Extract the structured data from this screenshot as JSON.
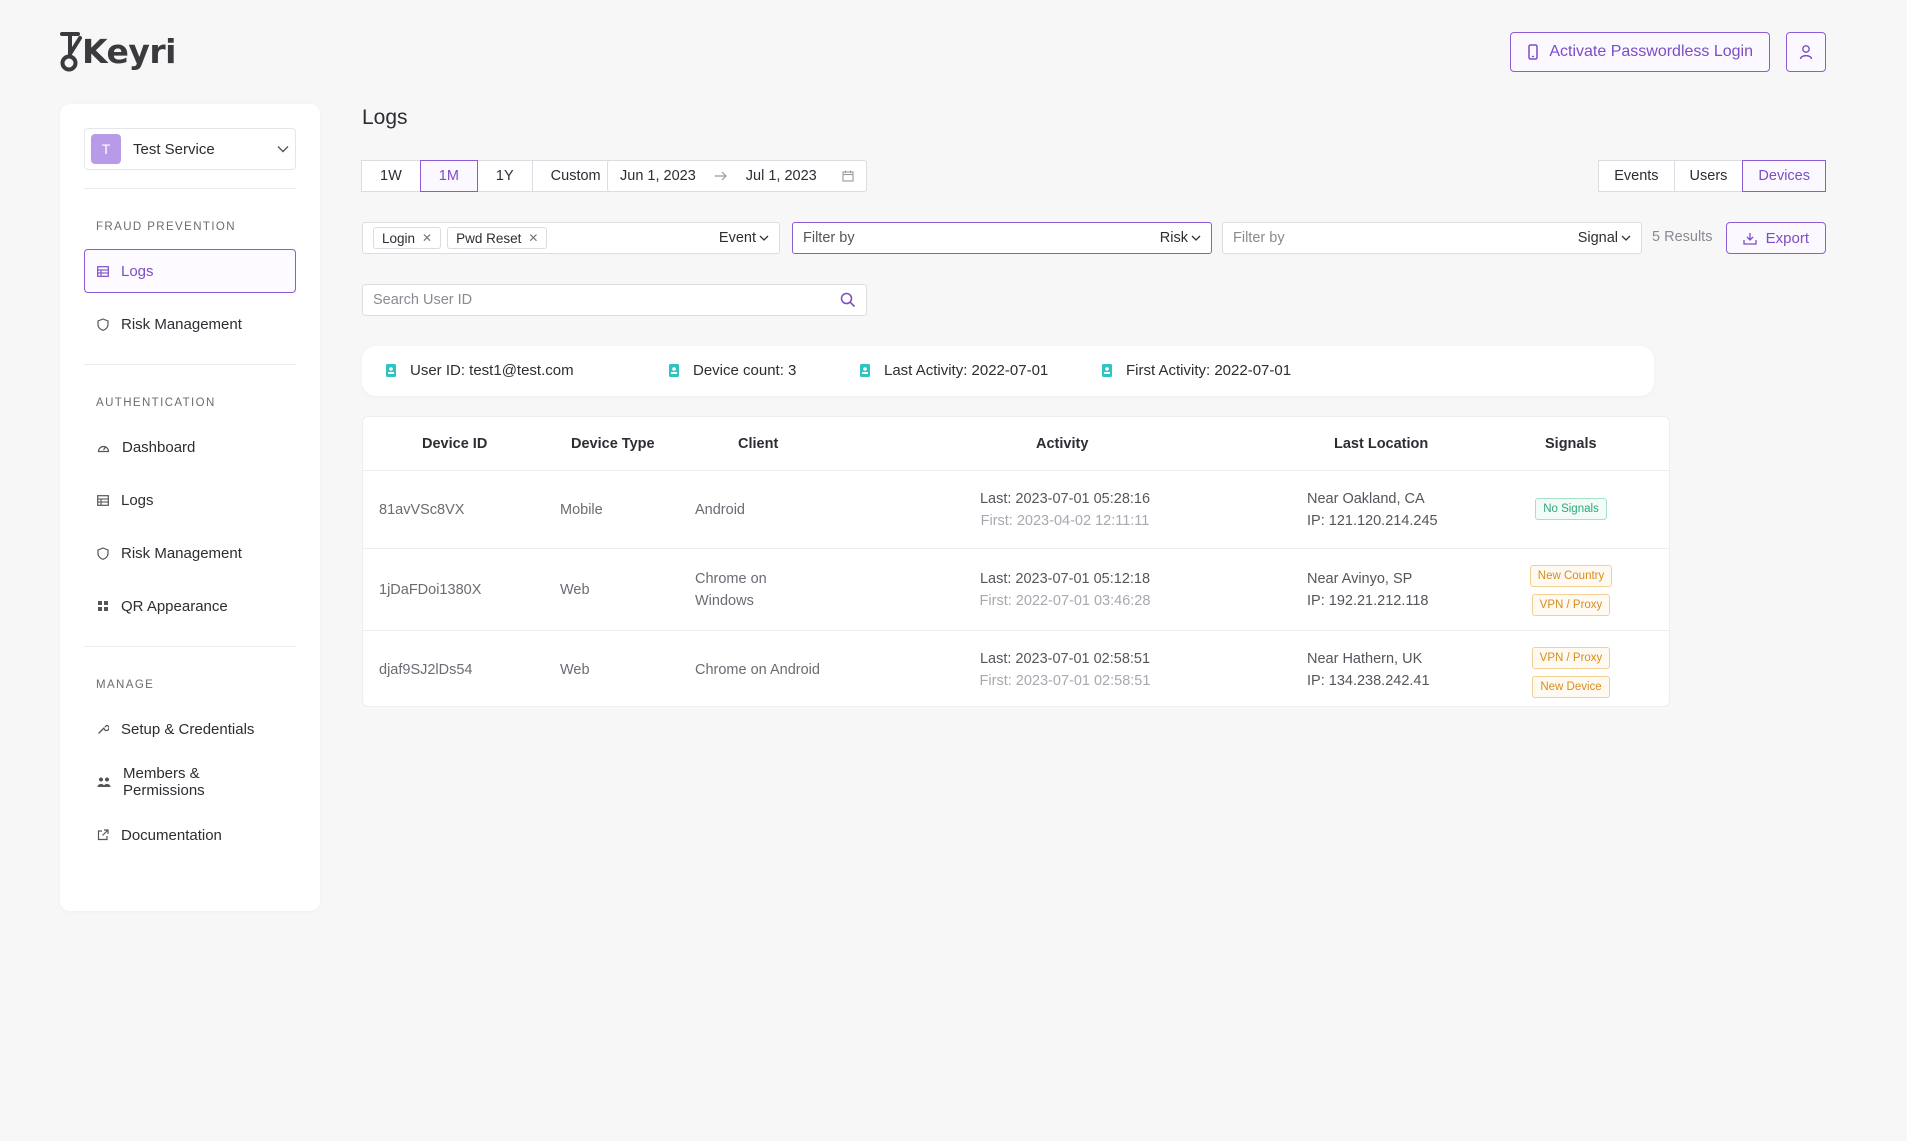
{
  "brand": {
    "name": "Keyri",
    "accent": "#8b5cd6"
  },
  "header": {
    "activate_label": "Activate Passwordless Login"
  },
  "sidebar": {
    "service": {
      "initial": "T",
      "name": "Test Service"
    },
    "sections": [
      {
        "title": "FRAUD PREVENTION",
        "items": [
          "Logs",
          "Risk Management"
        ]
      },
      {
        "title": "AUTHENTICATION",
        "items": [
          "Dashboard",
          "Logs",
          "Risk Management",
          "QR Appearance"
        ]
      },
      {
        "title": "MANAGE",
        "items": [
          "Setup & Credentials",
          "Members & Permissions",
          "Documentation"
        ]
      }
    ]
  },
  "main": {
    "title": "Logs",
    "ranges": [
      "1W",
      "1M",
      "1Y",
      "Custom"
    ],
    "date_from": "Jun 1, 2023",
    "date_to": "Jul 1, 2023",
    "views": [
      "Events",
      "Users",
      "Devices"
    ],
    "filters": {
      "event_chips": [
        "Login",
        "Pwd Reset"
      ],
      "event_label": "Event",
      "risk_placeholder": "Filter by",
      "risk_label": "Risk",
      "signal_placeholder": "Filter by",
      "signal_label": "Signal"
    },
    "results": "5 Results",
    "export_label": "Export",
    "search_placeholder": "Search User ID",
    "summary": {
      "user_id": "User ID: test1@test.com",
      "device_count": "Device count: 3",
      "last_activity": "Last Activity: 2022-07-01",
      "first_activity": "First Activity: 2022-07-01"
    },
    "table": {
      "columns": [
        "Device ID",
        "Device Type",
        "Client",
        "Activity",
        "Last Location",
        "Signals"
      ],
      "rows": [
        {
          "device_id": "81avVSc8VX",
          "type": "Mobile",
          "client": "Android",
          "last": "Last: 2023-07-01 05:28:16",
          "first": "First: 2023-04-02 12:11:11",
          "location": "Near Oakland, CA",
          "ip": "IP: 121.120.214.245",
          "signals": [
            {
              "label": "No Signals",
              "tone": "green"
            }
          ]
        },
        {
          "device_id": "1jDaFDoi1380X",
          "type": "Web",
          "client": "Chrome on Windows",
          "last": "Last: 2023-07-01 05:12:18",
          "first": "First: 2022-07-01 03:46:28",
          "location": "Near Avinyo, SP",
          "ip": "IP: 192.21.212.118",
          "signals": [
            {
              "label": "New Country",
              "tone": "orange"
            },
            {
              "label": "VPN / Proxy",
              "tone": "orange"
            }
          ]
        },
        {
          "device_id": "djaf9SJ2lDs54",
          "type": "Web",
          "client": "Chrome on Android",
          "last": "Last: 2023-07-01 02:58:51",
          "first": "First: 2023-07-01 02:58:51",
          "location": "Near Hathern, UK",
          "ip": "IP: 134.238.242.41",
          "signals": [
            {
              "label": "VPN / Proxy",
              "tone": "orange"
            },
            {
              "label": "New Device",
              "tone": "orange"
            }
          ]
        }
      ]
    }
  }
}
